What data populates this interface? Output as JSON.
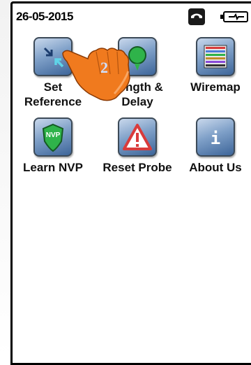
{
  "status_bar": {
    "date": "26-05-2015",
    "phone_icon": "phone-icon",
    "battery_icon": "battery-icon"
  },
  "apps": [
    {
      "label_line1": "Set",
      "label_line2": "Reference",
      "icon": "arrows-in-icon"
    },
    {
      "label_line1": "Length &",
      "label_line2": "Delay",
      "icon": "green-dot-icon"
    },
    {
      "label_line1": "Wiremap",
      "label_line2": "",
      "icon": "wiremap-grid-icon"
    },
    {
      "label_line1": "Learn NVP",
      "label_line2": "",
      "icon": "nvp-badge-icon"
    },
    {
      "label_line1": "Reset Probe",
      "label_line2": "",
      "icon": "warning-triangle-icon"
    },
    {
      "label_line1": "About Us",
      "label_line2": "",
      "icon": "info-icon"
    }
  ],
  "overlay": {
    "step_number": "2",
    "hand_color": "#f07a1e"
  }
}
